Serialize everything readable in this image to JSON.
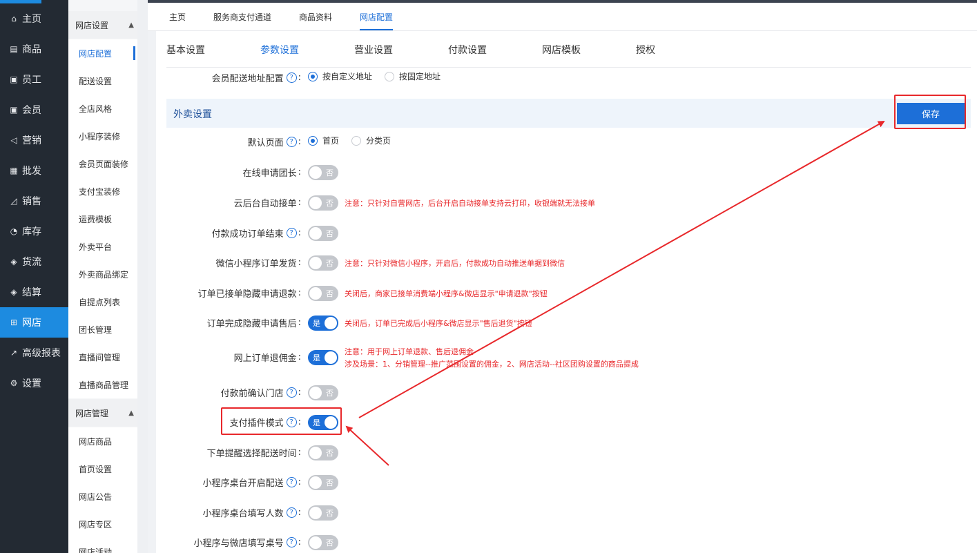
{
  "nav": {
    "items": [
      {
        "label": "主页",
        "icon": "home-icon",
        "glyph": "⌂"
      },
      {
        "label": "商品",
        "icon": "goods-icon",
        "glyph": "▤"
      },
      {
        "label": "员工",
        "icon": "staff-icon",
        "glyph": "▣"
      },
      {
        "label": "会员",
        "icon": "member-icon",
        "glyph": "▣"
      },
      {
        "label": "营销",
        "icon": "megaphone-icon",
        "glyph": "◁"
      },
      {
        "label": "批发",
        "icon": "wholesale-icon",
        "glyph": "▦"
      },
      {
        "label": "销售",
        "icon": "sales-chart-icon",
        "glyph": "◿"
      },
      {
        "label": "库存",
        "icon": "inventory-pie-icon",
        "glyph": "◔"
      },
      {
        "label": "货流",
        "icon": "goods-flow-icon",
        "glyph": "◈"
      },
      {
        "label": "结算",
        "icon": "settlement-icon",
        "glyph": "◈"
      },
      {
        "label": "网店",
        "icon": "gift-icon",
        "glyph": "⊞"
      },
      {
        "label": "高级报表",
        "icon": "report-icon",
        "glyph": "↗"
      },
      {
        "label": "设置",
        "icon": "gear-icon",
        "glyph": "⚙"
      }
    ],
    "active_index": 10
  },
  "subnav": {
    "group1": "网店设置",
    "items1": [
      "网店配置",
      "配送设置",
      "全店风格",
      "小程序装修",
      "会员页面装修",
      "支付宝装修",
      "运费模板",
      "外卖平台",
      "外卖商品绑定",
      "自提点列表",
      "团长管理",
      "直播间管理",
      "直播商品管理"
    ],
    "group2": "网店管理",
    "items2": [
      "网店商品",
      "首页设置",
      "网店公告",
      "网店专区",
      "网店活动"
    ]
  },
  "topbar": {
    "tabs": [
      "主页",
      "服务商支付通道",
      "商品资料",
      "网店配置"
    ],
    "active_index": 3
  },
  "panel_tabs": {
    "tabs": [
      "基本设置",
      "参数设置",
      "营业设置",
      "付款设置",
      "网店模板",
      "授权"
    ],
    "active_index": 1
  },
  "member_address": {
    "label": "会员配送地址配置",
    "option1": "按自定义地址",
    "option2": "按固定地址",
    "selected": 1
  },
  "section": {
    "title": "外卖设置",
    "save_label": "保存"
  },
  "default_page": {
    "label": "默认页面",
    "option1": "首页",
    "option2": "分类页",
    "selected": 1
  },
  "switch_on_text": "是",
  "switch_off_text": "否",
  "settings": [
    {
      "label": "在线申请团长",
      "help": false,
      "on": false
    },
    {
      "label": "云后台自动接单",
      "help": false,
      "on": false,
      "note": "注意：只针对自营网店，后台开启自动接单支持云打印，收银端就无法接单"
    },
    {
      "label": "付款成功订单结束",
      "help": true,
      "on": false
    },
    {
      "label": "微信小程序订单发货",
      "help": false,
      "on": false,
      "note": "注意：只针对微信小程序，开启后，付款成功自动推送单据到微信"
    },
    {
      "label": "订单已接单隐藏申请退款",
      "help": false,
      "on": false,
      "note": "关闭后，商家已接单消费端小程序&微店显示\"申请退款\"按钮"
    },
    {
      "label": "订单完成隐藏申请售后",
      "help": false,
      "on": true,
      "note": "关闭后，订单已完成后小程序&微店显示\"售后退货\"按钮"
    },
    {
      "label": "网上订单退佣金",
      "help": false,
      "on": true,
      "note": "注意：用于网上订单退款、售后退佣金",
      "note2": "涉及场景：1、分销管理--推广范围设置的佣金，2、网店活动--社区团购设置的商品提成"
    },
    {
      "label": "付款前确认门店",
      "help": true,
      "on": false
    },
    {
      "label": "支付插件模式",
      "help": true,
      "on": true
    },
    {
      "label": "下单提醒选择配送时间",
      "help": false,
      "on": false
    },
    {
      "label": "小程序桌台开启配送",
      "help": true,
      "on": false
    },
    {
      "label": "小程序桌台填写人数",
      "help": true,
      "on": false
    },
    {
      "label": "小程序与微店填写桌号",
      "help": true,
      "on": false
    }
  ],
  "help_glyph": "?",
  "colors": {
    "accent": "#1d6fd8",
    "nav_bg": "#232a33",
    "annotation": "#e8282b"
  }
}
